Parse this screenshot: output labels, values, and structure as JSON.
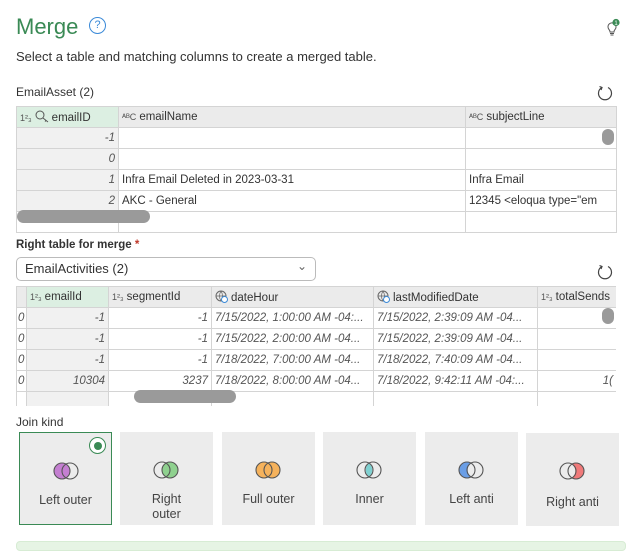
{
  "header": {
    "title": "Merge",
    "help_icon": "question-circle-icon",
    "bulb_icon": "lightbulb-icon",
    "bulb_badge": "1",
    "subtitle": "Select a table and matching columns to create a merged table."
  },
  "left_table": {
    "label": "EmailAsset (2)",
    "columns": [
      {
        "type": "1²₃",
        "name": "emailID",
        "key": true
      },
      {
        "type": "ABC",
        "name": "emailName"
      },
      {
        "type": "ABC",
        "name": "subjectLine"
      }
    ],
    "rows": [
      [
        "-1",
        "",
        ""
      ],
      [
        "0",
        "",
        ""
      ],
      [
        "1",
        "Infra Email Deleted in 2023-03-31",
        "Infra Email"
      ],
      [
        "2",
        "AKC - General",
        "12345 <eloqua type=\"em"
      ]
    ]
  },
  "right_table": {
    "label": "Right table for merge",
    "required_mark": "*",
    "selected": "EmailActivities (2)",
    "columns": [
      {
        "type": "1²₃",
        "name": "emailId",
        "key": true
      },
      {
        "type": "1²₃",
        "name": "segmentId"
      },
      {
        "type": "datetimezone",
        "name": "dateHour"
      },
      {
        "type": "datetimezone",
        "name": "lastModifiedDate"
      },
      {
        "type": "1²₃",
        "name": "totalSends"
      }
    ],
    "rows": [
      [
        "0",
        "-1",
        "-1",
        "7/15/2022, 1:00:00 AM -04:...",
        "7/15/2022, 2:39:09 AM -04...",
        ""
      ],
      [
        "0",
        "-1",
        "-1",
        "7/15/2022, 2:00:00 AM -04...",
        "7/15/2022, 2:39:09 AM -04...",
        ""
      ],
      [
        "0",
        "-1",
        "-1",
        "7/18/2022, 7:00:00 AM -04...",
        "7/18/2022, 7:40:09 AM -04...",
        ""
      ],
      [
        "0",
        "10304",
        "3237",
        "7/18/2022, 8:00:00 AM -04...",
        "7/18/2022, 9:42:11 AM -04:...",
        "1("
      ]
    ]
  },
  "join": {
    "label": "Join kind",
    "selected": "Left outer",
    "options": [
      {
        "label": "Left outer",
        "color": "#c47fd1"
      },
      {
        "label": "Right outer",
        "color": "#8fd18f"
      },
      {
        "label": "Full outer",
        "color": "#f5b25c"
      },
      {
        "label": "Inner",
        "color": "#7fd1d1"
      },
      {
        "label": "Left anti",
        "color": "#6a9ee6"
      },
      {
        "label": "Right anti",
        "color": "#f07a7a"
      }
    ]
  },
  "colors": {
    "accent": "#3a8a55",
    "key_header": "#dcefe2"
  }
}
